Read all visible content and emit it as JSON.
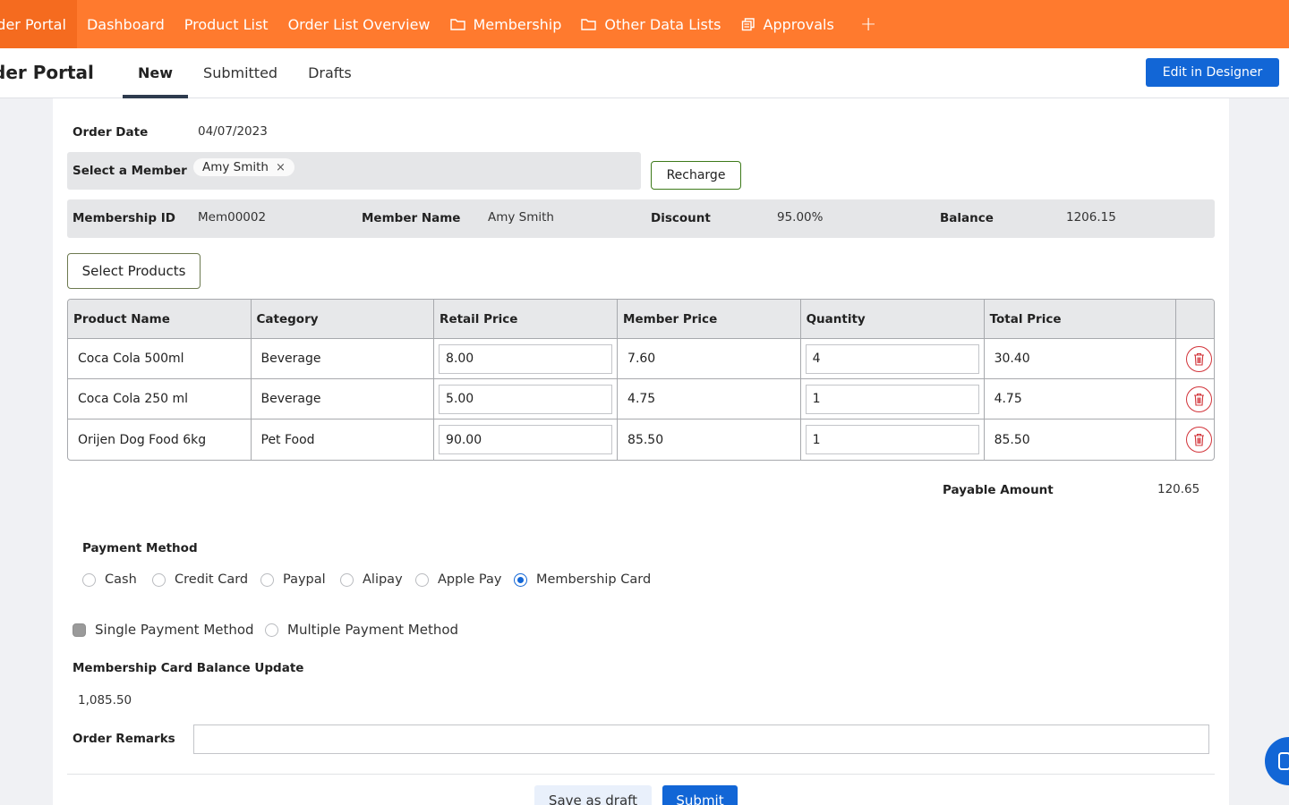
{
  "topnav": {
    "items": [
      {
        "label": "rder Portal",
        "icon": null
      },
      {
        "label": "Dashboard",
        "icon": null
      },
      {
        "label": "Product List",
        "icon": null
      },
      {
        "label": "Order List Overview",
        "icon": null
      },
      {
        "label": "Membership",
        "icon": "folder-icon"
      },
      {
        "label": "Other Data Lists",
        "icon": "folder-icon"
      },
      {
        "label": "Approvals",
        "icon": "copy-icon"
      }
    ],
    "add_label": "+"
  },
  "header": {
    "portal_title": "der Portal",
    "tabs": [
      "New",
      "Submitted",
      "Drafts"
    ],
    "active_tab": "New",
    "designer_button": "Edit in Designer"
  },
  "form": {
    "order_date_label": "Order Date",
    "order_date_value": "04/07/2023",
    "select_member_label": "Select a Member",
    "selected_member": "Amy Smith",
    "chip_remove": "×",
    "recharge_button": "Recharge",
    "membership_id_label": "Membership ID",
    "membership_id_value": "Mem00002",
    "member_name_label": "Member Name",
    "member_name_value": "Amy Smith",
    "discount_label": "Discount",
    "discount_value": "95.00%",
    "balance_label": "Balance",
    "balance_value": "1206.15",
    "select_products_button": "Select Products"
  },
  "table": {
    "columns": [
      "Product Name",
      "Category",
      "Retail Price",
      "Member Price",
      "Quantity",
      "Total Price",
      ""
    ],
    "rows": [
      {
        "product": "Coca Cola 500ml",
        "category": "Beverage",
        "retail": "8.00",
        "member": "7.60",
        "qty": "4",
        "total": "30.40"
      },
      {
        "product": "Coca Cola 250 ml",
        "category": "Beverage",
        "retail": "5.00",
        "member": "4.75",
        "qty": "1",
        "total": "4.75"
      },
      {
        "product": "Orijen Dog Food 6kg",
        "category": "Pet Food",
        "retail": "90.00",
        "member": "85.50",
        "qty": "1",
        "total": "85.50"
      }
    ]
  },
  "payable": {
    "label": "Payable Amount",
    "value": "120.65"
  },
  "payment": {
    "label": "Payment Method",
    "options": [
      "Cash",
      "Credit Card",
      "Paypal",
      "Alipay",
      "Apple Pay",
      "Membership Card"
    ],
    "selected": "Membership Card"
  },
  "payment_type": {
    "options": [
      "Single Payment Method",
      "Multiple Payment Method"
    ],
    "selected": "Single Payment Method"
  },
  "balance_update": {
    "label": "Membership Card Balance Update",
    "value": "1,085.50"
  },
  "remarks": {
    "label": "Order Remarks",
    "value": ""
  },
  "actions": {
    "draft": "Save as draft",
    "submit": "Submit"
  },
  "colors": {
    "nav": "#ff7a2e",
    "primary": "#1266d6",
    "danger": "#d2343a"
  }
}
